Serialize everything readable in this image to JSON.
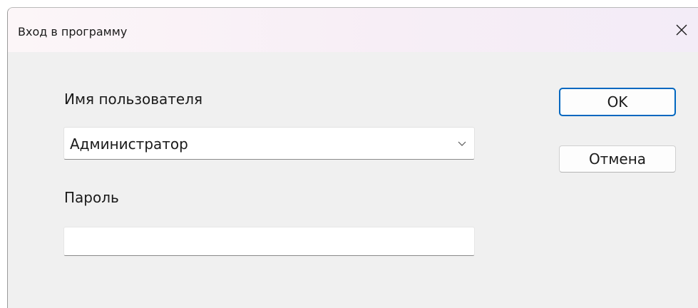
{
  "window": {
    "title": "Вход в программу"
  },
  "form": {
    "username_label": "Имя пользователя",
    "username_value": "Администратор",
    "password_label": "Пароль",
    "password_value": ""
  },
  "buttons": {
    "ok_label": "OK",
    "cancel_label": "Отмена"
  },
  "icons": {
    "close": "close-icon",
    "dropdown": "chevron-down-icon"
  },
  "colors": {
    "accent": "#0067c0",
    "window_bg": "#f0f0f0"
  }
}
